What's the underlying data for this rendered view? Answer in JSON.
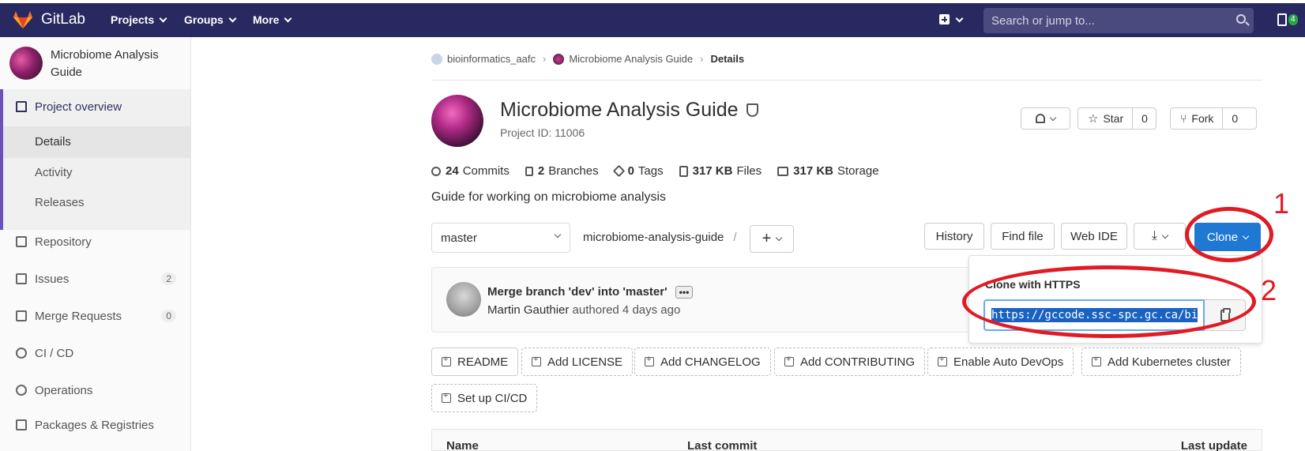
{
  "topbar": {
    "brand": "GitLab",
    "menus": [
      "Projects",
      "Groups",
      "More"
    ],
    "search_placeholder": "Search or jump to...",
    "todo_count": "4",
    "bg_color": "#292961"
  },
  "sidebar": {
    "project_name": "Microbiome Analysis Guide",
    "overview": "Project overview",
    "sub_items": [
      "Details",
      "Activity",
      "Releases"
    ],
    "items": [
      {
        "label": "Repository",
        "count": ""
      },
      {
        "label": "Issues",
        "count": "2"
      },
      {
        "label": "Merge Requests",
        "count": "0"
      },
      {
        "label": "CI / CD",
        "count": ""
      },
      {
        "label": "Operations",
        "count": ""
      },
      {
        "label": "Packages & Registries",
        "count": ""
      }
    ]
  },
  "breadcrumb": {
    "group": "bioinformatics_aafc",
    "project": "Microbiome Analysis Guide",
    "current": "Details"
  },
  "project": {
    "title": "Microbiome Analysis Guide",
    "id_text": "Project ID: 11006",
    "star_label": "Star",
    "star_count": "0",
    "fork_label": "Fork",
    "fork_count": "0",
    "description": "Guide for working on microbiome analysis"
  },
  "stats": [
    {
      "value": "24",
      "label": "Commits"
    },
    {
      "value": "2",
      "label": "Branches"
    },
    {
      "value": "0",
      "label": "Tags"
    },
    {
      "value": "317 KB",
      "label": "Files"
    },
    {
      "value": "317 KB",
      "label": "Storage"
    }
  ],
  "toolbar": {
    "branch": "master",
    "path": "microbiome-analysis-guide",
    "path_sep": "/",
    "history": "History",
    "find_file": "Find file",
    "web_ide": "Web IDE",
    "clone": "Clone"
  },
  "commit": {
    "title": "Merge branch 'dev' into 'master'",
    "ellipsis": "•••",
    "author": "Martin Gauthier",
    "meta": "authored 4 days ago"
  },
  "clone_dropdown": {
    "label": "Clone with HTTPS",
    "url": "https://gccode.ssc-spc.gc.ca/bi"
  },
  "annotations": {
    "one": "1",
    "two": "2",
    "color": "#e01b24"
  },
  "file_buttons": [
    "README",
    "Add LICENSE",
    "Add CHANGELOG",
    "Add CONTRIBUTING",
    "Enable Auto DevOps",
    "Add Kubernetes cluster",
    "Set up CI/CD"
  ],
  "table": {
    "col_name": "Name",
    "col_commit": "Last commit",
    "col_update": "Last update"
  }
}
